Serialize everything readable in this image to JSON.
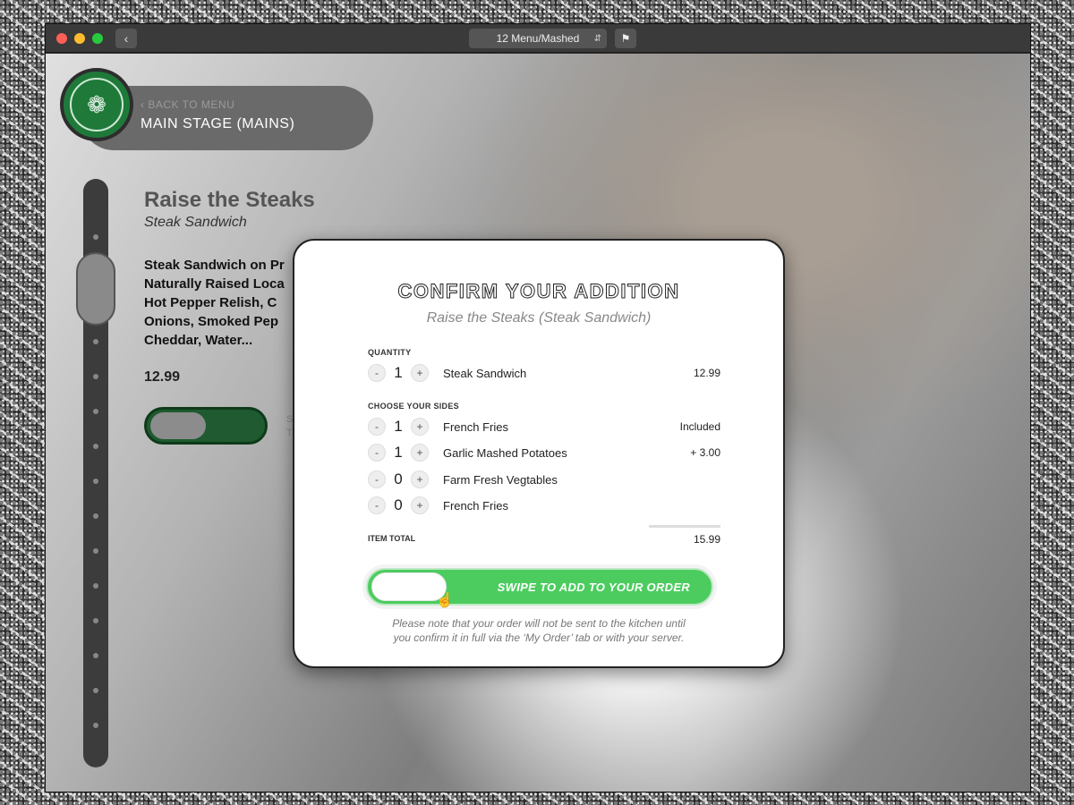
{
  "window": {
    "page_selector": "12 Menu/Mashed",
    "back_icon": "chevron-left-icon",
    "flag_icon": "flag-icon"
  },
  "header": {
    "back_label": "BACK TO MENU",
    "title": "MAIN STAGE (MAINS)",
    "logo_icon": "fork-spoon-icon"
  },
  "menu_item": {
    "title": "Raise the Steaks",
    "subtitle": "Steak Sandwich",
    "description_lines": [
      "Steak Sandwich on Pr",
      "Naturally Raised Loca",
      "Hot Pepper Relish, C",
      "Onions, Smoked Pep",
      "Cheddar, Water..."
    ],
    "price": "12.99",
    "swipe_hint_lines": [
      "SW",
      "TO"
    ]
  },
  "modal": {
    "title": "CONFIRM YOUR ADDITION",
    "subtitle": "Raise the Steaks (Steak Sandwich)",
    "quantity_label": "QUANTITY",
    "main": {
      "minus": "-",
      "qty": "1",
      "plus": "+",
      "name": "Steak Sandwich",
      "price": "12.99"
    },
    "sides_label": "CHOOSE YOUR SIDES",
    "sides": [
      {
        "minus": "-",
        "qty": "1",
        "plus": "+",
        "name": "French Fries",
        "price": "Included"
      },
      {
        "minus": "-",
        "qty": "1",
        "plus": "+",
        "name": "Garlic Mashed Potatoes",
        "price": "+ 3.00"
      },
      {
        "minus": "-",
        "qty": "0",
        "plus": "+",
        "name": "Farm Fresh Vegtables",
        "price": ""
      },
      {
        "minus": "-",
        "qty": "0",
        "plus": "+",
        "name": "French Fries",
        "price": ""
      }
    ],
    "total_label": "ITEM TOTAL",
    "total_value": "15.99",
    "swipe_label": "SWIPE TO ADD TO YOUR ORDER",
    "note_lines": [
      "Please note that your order will not be sent to the kitchen until",
      "you confirm it in full via the ‘My Order’ tab or with your server."
    ]
  },
  "colors": {
    "brand_green": "#1f7a3a",
    "swipe_green": "#4ccc5f"
  }
}
